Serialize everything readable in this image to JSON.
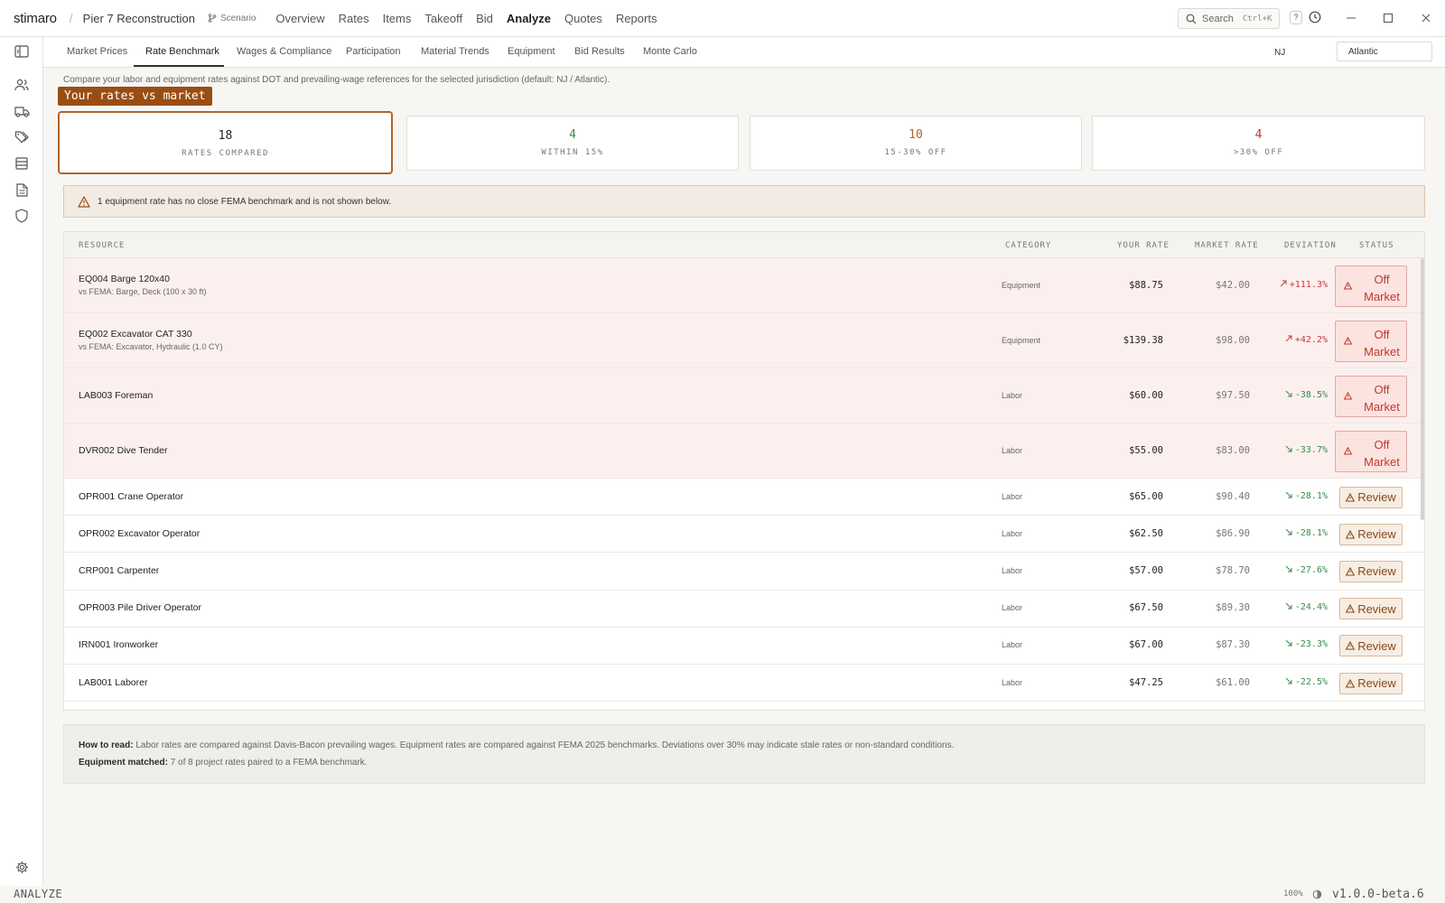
{
  "app": {
    "brand": "stimaro",
    "project": "Pier 7 Reconstruction",
    "scenario": "Scenario",
    "nav": [
      "Overview",
      "Rates",
      "Items",
      "Takeoff",
      "Bid",
      "Analyze",
      "Quotes",
      "Reports"
    ],
    "active_nav": "Analyze",
    "search_label": "Search",
    "search_shortcut": "Ctrl+K",
    "help_label": "?"
  },
  "subtabs": [
    "Market Prices",
    "Rate Benchmark",
    "Wages & Compliance",
    "Participation",
    "Material Trends",
    "Equipment",
    "Bid Results",
    "Monte Carlo"
  ],
  "active_subtab": "Rate Benchmark",
  "jurisdiction": {
    "state": "NJ",
    "county": "Atlantic"
  },
  "description": "Compare your labor and equipment rates against DOT and prevailing-wage references for the selected jurisdiction (default: NJ / Atlantic).",
  "ribbon": "Your rates vs market",
  "stats": [
    {
      "value": "18",
      "label": "RATES COMPARED",
      "color": "#222222"
    },
    {
      "value": "4",
      "label": "WITHIN 15%",
      "color": "#3a8a4a"
    },
    {
      "value": "10",
      "label": "15-30% OFF",
      "color": "#b3642b"
    },
    {
      "value": "4",
      "label": ">30% OFF",
      "color": "#c0392b"
    }
  ],
  "warning": "1 equipment rate has no close FEMA benchmark and is not shown below.",
  "table": {
    "headers": {
      "resource": "RESOURCE",
      "category": "CATEGORY",
      "your_rate": "YOUR RATE",
      "market_rate": "MARKET RATE",
      "deviation": "DEVIATION",
      "status": "STATUS"
    },
    "rows": [
      {
        "name": "EQ004 Barge 120x40",
        "sub": "vs FEMA: Barge, Deck (100 x 30 ft)",
        "category": "Equipment",
        "your_rate": "$88.75",
        "market_rate": "$42.00",
        "deviation": "+111.3%",
        "dir": "up",
        "status": "Off Market"
      },
      {
        "name": "EQ002 Excavator CAT 330",
        "sub": "vs FEMA: Excavator, Hydraulic (1.0 CY)",
        "category": "Equipment",
        "your_rate": "$139.38",
        "market_rate": "$98.00",
        "deviation": "+42.2%",
        "dir": "up",
        "status": "Off Market"
      },
      {
        "name": "LAB003 Foreman",
        "sub": "",
        "category": "Labor",
        "your_rate": "$60.00",
        "market_rate": "$97.50",
        "deviation": "-38.5%",
        "dir": "down",
        "status": "Off Market"
      },
      {
        "name": "DVR002 Dive Tender",
        "sub": "",
        "category": "Labor",
        "your_rate": "$55.00",
        "market_rate": "$83.00",
        "deviation": "-33.7%",
        "dir": "down",
        "status": "Off Market"
      },
      {
        "name": "OPR001 Crane Operator",
        "sub": "",
        "category": "Labor",
        "your_rate": "$65.00",
        "market_rate": "$90.40",
        "deviation": "-28.1%",
        "dir": "down",
        "status": "Review"
      },
      {
        "name": "OPR002 Excavator Operator",
        "sub": "",
        "category": "Labor",
        "your_rate": "$62.50",
        "market_rate": "$86.90",
        "deviation": "-28.1%",
        "dir": "down",
        "status": "Review"
      },
      {
        "name": "CRP001 Carpenter",
        "sub": "",
        "category": "Labor",
        "your_rate": "$57.00",
        "market_rate": "$78.70",
        "deviation": "-27.6%",
        "dir": "down",
        "status": "Review"
      },
      {
        "name": "OPR003 Pile Driver Operator",
        "sub": "",
        "category": "Labor",
        "your_rate": "$67.50",
        "market_rate": "$89.30",
        "deviation": "-24.4%",
        "dir": "down",
        "status": "Review"
      },
      {
        "name": "IRN001 Ironworker",
        "sub": "",
        "category": "Labor",
        "your_rate": "$67.00",
        "market_rate": "$87.30",
        "deviation": "-23.3%",
        "dir": "down",
        "status": "Review"
      },
      {
        "name": "LAB001 Laborer",
        "sub": "",
        "category": "Labor",
        "your_rate": "$47.25",
        "market_rate": "$61.00",
        "deviation": "-22.5%",
        "dir": "down",
        "status": "Review"
      }
    ]
  },
  "howto": {
    "label1": "How to read:",
    "text1": "Labor rates are compared against Davis-Bacon prevailing wages. Equipment rates are compared against FEMA 2025 benchmarks. Deviations over 30% may indicate stale rates or non-standard conditions.",
    "label2": "Equipment matched:",
    "text2": "7 of 8 project rates paired to a FEMA benchmark."
  },
  "statusbar": {
    "mode": "ANALYZE",
    "zoom": "100%",
    "version": "v1.0.0-beta.6"
  }
}
